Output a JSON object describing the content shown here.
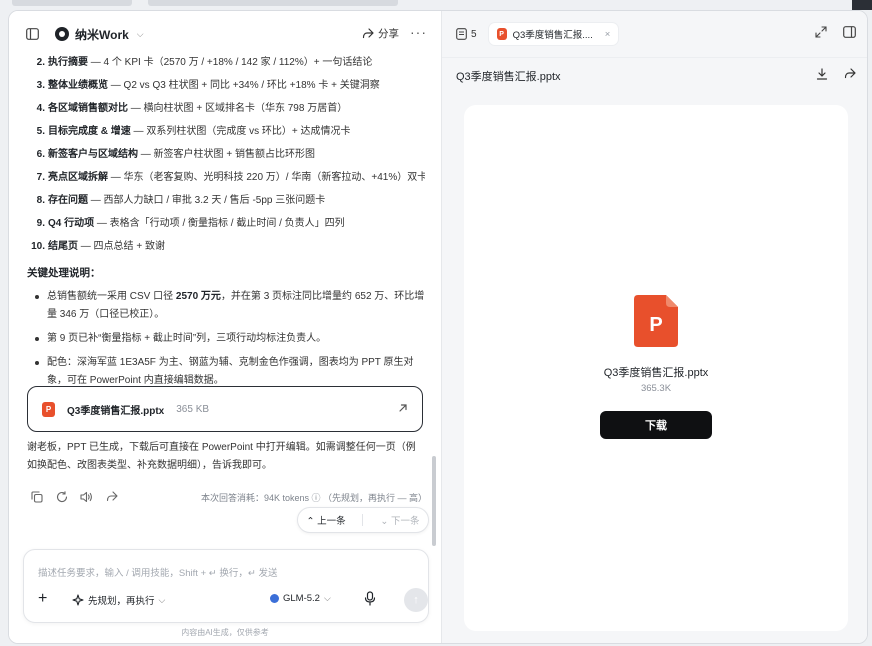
{
  "header": {
    "brand": "纳米Work",
    "share_label": "分享"
  },
  "outline": [
    {
      "num": "2.",
      "title": "执行摘要",
      "rest": " — 4 个 KPI 卡（2570 万 / +18% / 142 家 / 112%）+ 一句话结论"
    },
    {
      "num": "3.",
      "title": "整体业绩概览",
      "rest": " — Q2 vs Q3 柱状图 + 同比 +34% / 环比 +18% 卡 + 关键洞察"
    },
    {
      "num": "4.",
      "title": "各区域销售额对比",
      "rest": " — 横向柱状图 + 区域排名卡（华东 798 万居首）"
    },
    {
      "num": "5.",
      "title": "目标完成度 & 增速",
      "rest": " — 双系列柱状图（完成度 vs 环比）+ 达成情况卡"
    },
    {
      "num": "6.",
      "title": "新签客户与区域结构",
      "rest": " — 新签客户柱状图 + 销售额占比环形图"
    },
    {
      "num": "7.",
      "title": "亮点区域拆解",
      "rest": " — 华东（老客复购、光明科技 220 万）/ 华南（新客拉动、+41%）双卡"
    },
    {
      "num": "8.",
      "title": "存在问题",
      "rest": " — 西部人力缺口 / 审批 3.2 天 / 售后 -5pp 三张问题卡"
    },
    {
      "num": "9.",
      "title": "Q4 行动项",
      "rest": " — 表格含「行动项 / 衡量指标 / 截止时间 / 负责人」四列"
    },
    {
      "num": "10.",
      "title": "结尾页",
      "rest": " — 四点总结 + 致谢"
    }
  ],
  "notes_title": "关键处理说明：",
  "notes": [
    {
      "pre": "总销售额统一采用 CSV 口径 ",
      "bold": "2570 万元",
      "post": "，并在第 3 页标注同比增量约 652 万、环比增量 346 万（口径已校正）。"
    },
    {
      "pre": "第 9 页已补“衡量指标 + 截止时间”列，三项行动均标注负责人。",
      "bold": "",
      "post": ""
    },
    {
      "pre": "配色：深海军蓝 1E3A5F 为主、钢蓝为辅、克制金色作强调，图表均为 PPT 原生对象，可在 PowerPoint 内直接编辑数据。",
      "bold": "",
      "post": ""
    }
  ],
  "attachment": {
    "name": "Q3季度销售汇报.pptx",
    "size": "365 KB",
    "icon_letter": "P"
  },
  "reply_text": "谢老板，PPT 已生成，下载后可直接在 PowerPoint 中打开编辑。如需调整任何一页（例如换配色、改图表类型、补充数据明细），告诉我即可。",
  "usage_text": "本次回答消耗：94K tokens ⓘ （先规划，再执行 — 高）",
  "nav": {
    "prev": "上一条",
    "next": "下一条"
  },
  "composer": {
    "placeholder": "描述任务要求，输入 / 调用技能，Shift + ↵ 换行，↵ 发送",
    "mode": "先规划，再执行",
    "model": "GLM-5.2"
  },
  "disclaimer": "内容由AI生成，仅供参考",
  "right": {
    "tab_count": "5",
    "tab_file": "Q3季度销售汇报....",
    "file_title": "Q3季度销售汇报.pptx",
    "preview_name": "Q3季度销售汇报.pptx",
    "preview_size": "365.3K",
    "download_label": "下载",
    "icon_letter": "P"
  },
  "colors": {
    "ppt": "#e8502c",
    "button": "#0f1012"
  }
}
